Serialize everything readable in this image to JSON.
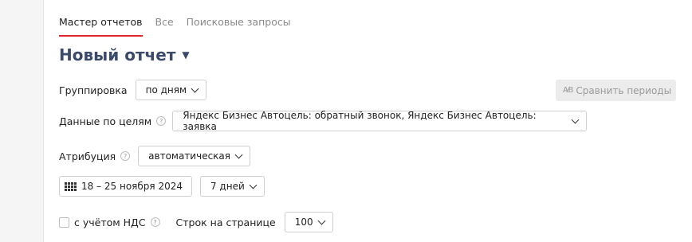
{
  "tabs": [
    {
      "label": "Мастер отчетов",
      "active": true
    },
    {
      "label": "Все",
      "active": false
    },
    {
      "label": "Поисковые запросы",
      "active": false
    }
  ],
  "report": {
    "title": "Новый отчет"
  },
  "grouping": {
    "label": "Группировка",
    "value": "по дням"
  },
  "compare": {
    "label": "Сравнить периоды",
    "icon": "compare-periods-icon",
    "disabled": true
  },
  "goals": {
    "label": "Данные по целям",
    "value": "Яндекс Бизнес Автоцель: обратный звонок, Яндекс Бизнес Автоцель: заявка"
  },
  "attribution": {
    "label": "Атрибуция",
    "value": "автоматическая"
  },
  "date": {
    "range": "18 – 25 ноября 2024",
    "period": "7 дней"
  },
  "vat": {
    "label": "с учётом НДС",
    "checked": false
  },
  "rows_per_page": {
    "label": "Строк на странице",
    "value": "100"
  },
  "colors": {
    "accent_tab": "#e0262b",
    "title": "#3b4a6b"
  }
}
